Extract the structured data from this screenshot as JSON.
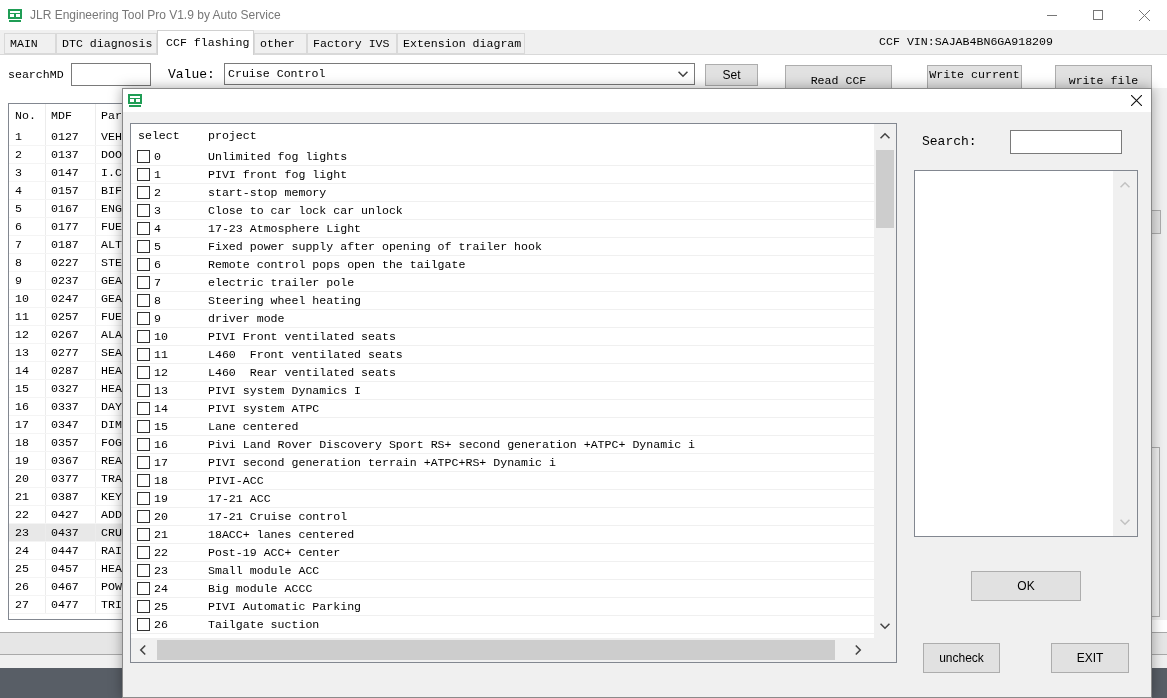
{
  "window": {
    "title": "JLR Engineering Tool Pro V1.9 by Auto Service"
  },
  "tabs": [
    {
      "label": "MAIN",
      "selected": false
    },
    {
      "label": "DTC diagnosis",
      "selected": false
    },
    {
      "label": "CCF flashing",
      "selected": true
    },
    {
      "label": "other",
      "selected": false
    },
    {
      "label": "Factory IVS",
      "selected": false
    },
    {
      "label": "Extension diagram",
      "selected": false
    }
  ],
  "vin": "CCF VIN:SAJAB4BN6GA918209",
  "toolbar": {
    "search_label": "searchMD",
    "value_label": "Value:",
    "value": "Cruise Control",
    "buttons": [
      "Set",
      "Read CCF",
      "Write current",
      "write file"
    ]
  },
  "table": {
    "columns": [
      "No.",
      "MDF",
      "Par"
    ],
    "rows": [
      {
        "cells": [
          "1",
          "0127",
          "VEH"
        ],
        "selected": false
      },
      {
        "cells": [
          "2",
          "0137",
          "DOO"
        ],
        "selected": false
      },
      {
        "cells": [
          "3",
          "0147",
          "I.C"
        ],
        "selected": false
      },
      {
        "cells": [
          "4",
          "0157",
          "BIF"
        ],
        "selected": false
      },
      {
        "cells": [
          "5",
          "0167",
          "ENG"
        ],
        "selected": false
      },
      {
        "cells": [
          "6",
          "0177",
          "FUE"
        ],
        "selected": false
      },
      {
        "cells": [
          "7",
          "0187",
          "ALT"
        ],
        "selected": false
      },
      {
        "cells": [
          "8",
          "0227",
          "STE"
        ],
        "selected": false
      },
      {
        "cells": [
          "9",
          "0237",
          "GEA"
        ],
        "selected": false
      },
      {
        "cells": [
          "10",
          "0247",
          "GEA"
        ],
        "selected": false
      },
      {
        "cells": [
          "11",
          "0257",
          "FUE"
        ],
        "selected": false
      },
      {
        "cells": [
          "12",
          "0267",
          "ALA"
        ],
        "selected": false
      },
      {
        "cells": [
          "13",
          "0277",
          "SEA"
        ],
        "selected": false
      },
      {
        "cells": [
          "14",
          "0287",
          "HEA"
        ],
        "selected": false
      },
      {
        "cells": [
          "15",
          "0327",
          "HEA"
        ],
        "selected": false
      },
      {
        "cells": [
          "16",
          "0337",
          "DAY"
        ],
        "selected": false
      },
      {
        "cells": [
          "17",
          "0347",
          "DIM"
        ],
        "selected": false
      },
      {
        "cells": [
          "18",
          "0357",
          "FOG"
        ],
        "selected": false
      },
      {
        "cells": [
          "19",
          "0367",
          "REA"
        ],
        "selected": false
      },
      {
        "cells": [
          "20",
          "0377",
          "TRA"
        ],
        "selected": false
      },
      {
        "cells": [
          "21",
          "0387",
          "KEY"
        ],
        "selected": false
      },
      {
        "cells": [
          "22",
          "0427",
          "ADD"
        ],
        "selected": false
      },
      {
        "cells": [
          "23",
          "0437",
          "CRU"
        ],
        "selected": true
      },
      {
        "cells": [
          "24",
          "0447",
          "RAI"
        ],
        "selected": false
      },
      {
        "cells": [
          "25",
          "0457",
          "HEA"
        ],
        "selected": false
      },
      {
        "cells": [
          "26",
          "0467",
          "POW"
        ],
        "selected": false
      },
      {
        "cells": [
          "27",
          "0477",
          "TRI"
        ],
        "selected": false
      }
    ]
  },
  "dialog": {
    "list": {
      "columns": [
        "select",
        "project"
      ],
      "rows": [
        {
          "checked": false,
          "number": "0",
          "project": "Unlimited fog lights"
        },
        {
          "checked": false,
          "number": "1",
          "project": "PIVI front fog light"
        },
        {
          "checked": false,
          "number": "2",
          "project": "start-stop memory"
        },
        {
          "checked": false,
          "number": "3",
          "project": "Close to car lock car unlock"
        },
        {
          "checked": false,
          "number": "4",
          "project": "17-23 Atmosphere Light"
        },
        {
          "checked": false,
          "number": "5",
          "project": "Fixed power supply after opening of trailer hook"
        },
        {
          "checked": false,
          "number": "6",
          "project": "Remote control pops open the tailgate"
        },
        {
          "checked": false,
          "number": "7",
          "project": "electric trailer pole"
        },
        {
          "checked": false,
          "number": "8",
          "project": "Steering wheel heating"
        },
        {
          "checked": false,
          "number": "9",
          "project": "driver mode"
        },
        {
          "checked": false,
          "number": "10",
          "project": "PIVI Front ventilated seats"
        },
        {
          "checked": false,
          "number": "11",
          "project": "L460  Front ventilated seats"
        },
        {
          "checked": false,
          "number": "12",
          "project": "L460  Rear ventilated seats"
        },
        {
          "checked": false,
          "number": "13",
          "project": "PIVI system Dynamics I"
        },
        {
          "checked": false,
          "number": "14",
          "project": "PIVI system ATPC"
        },
        {
          "checked": false,
          "number": "15",
          "project": "Lane centered"
        },
        {
          "checked": false,
          "number": "16",
          "project": "Pivi Land Rover Discovery Sport RS+ second generation +ATPC+ Dynamic i"
        },
        {
          "checked": false,
          "number": "17",
          "project": "PIVI second generation terrain +ATPC+RS+ Dynamic i"
        },
        {
          "checked": false,
          "number": "18",
          "project": "PIVI-ACC"
        },
        {
          "checked": false,
          "number": "19",
          "project": "17-21 ACC"
        },
        {
          "checked": false,
          "number": "20",
          "project": "17-21 Cruise control"
        },
        {
          "checked": false,
          "number": "21",
          "project": "18ACC+ lanes centered"
        },
        {
          "checked": false,
          "number": "22",
          "project": "Post-19 ACC+ Center"
        },
        {
          "checked": false,
          "number": "23",
          "project": "Small module ACC"
        },
        {
          "checked": false,
          "number": "24",
          "project": "Big module ACCC"
        },
        {
          "checked": false,
          "number": "25",
          "project": "PIVI Automatic Parking"
        },
        {
          "checked": false,
          "number": "26",
          "project": "Tailgate suction"
        }
      ]
    },
    "search_label": "Search:",
    "buttons": [
      "OK",
      "uncheck",
      "EXIT"
    ]
  }
}
